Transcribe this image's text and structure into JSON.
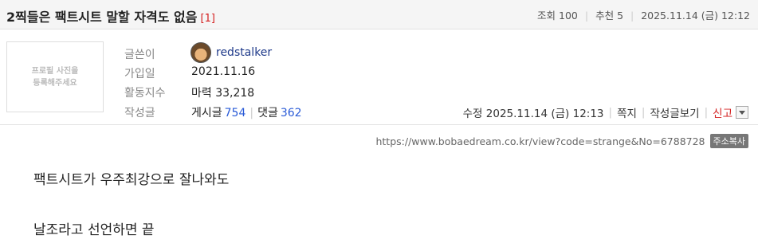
{
  "post": {
    "title": "2찍들은 팩트시트 말할 자격도 없음",
    "comment_count": "[1]",
    "views_label": "조회",
    "views": "100",
    "recommend_label": "추천",
    "recommend": "5",
    "datetime": "2025.11.14 (금) 12:12"
  },
  "profile": {
    "placeholder_line1": "프로필 사진을",
    "placeholder_line2": "등록해주세요"
  },
  "author": {
    "writer_label": "글쓴이",
    "username": "redstalker",
    "join_label": "가입일",
    "join_date": "2021.11.16",
    "activity_label": "활동지수",
    "activity_value": "마력 33,218",
    "posts_label": "작성글",
    "posts_text": "게시글",
    "posts_count": "754",
    "comments_text": "댓글",
    "comments_count": "362"
  },
  "actions": {
    "edit_info": "수정 2025.11.14 (금) 12:13",
    "message": "쪽지",
    "view_posts": "작성글보기",
    "report": "신고"
  },
  "url_row": {
    "url": "https://www.bobaedream.co.kr/view?code=strange&No=6788728",
    "copy_label": "주소복사"
  },
  "content": {
    "line1": "팩트시트가 우주최강으로 잘나와도",
    "line2": "날조라고 선언하면 끝"
  },
  "colors": {
    "accent_red": "#d42020",
    "link_blue": "#2a5bd7"
  }
}
